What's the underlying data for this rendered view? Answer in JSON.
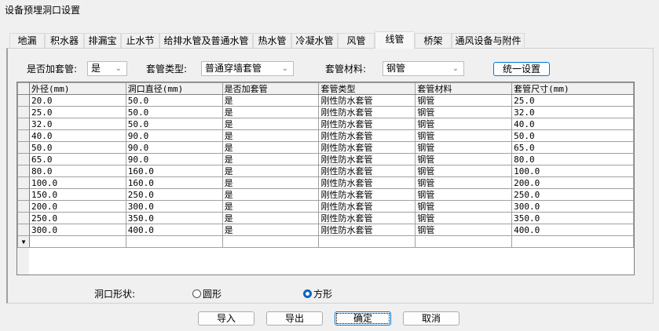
{
  "window": {
    "title": "设备预埋洞口设置"
  },
  "tabs": [
    "地漏",
    "积水器",
    "排漏宝",
    "止水节",
    "给排水管及普通水管",
    "热水管",
    "冷凝水管",
    "风管",
    "线管",
    "桥架",
    "通风设备与附件"
  ],
  "active_tab": "线管",
  "filters": {
    "add_sleeve_label": "是否加套管:",
    "add_sleeve_value": "是",
    "sleeve_type_label": "套管类型:",
    "sleeve_type_value": "普通穿墙套管",
    "sleeve_material_label": "套管材料:",
    "sleeve_material_value": "钢管",
    "apply_all_button": "统一设置"
  },
  "table": {
    "columns": [
      "外径(mm)",
      "洞口直径(mm)",
      "是否加套管",
      "套管类型",
      "套管材料",
      "套管尺寸(mm)"
    ],
    "rows": [
      [
        "20.0",
        "50.0",
        "是",
        "刚性防水套管",
        "钢管",
        "25.0"
      ],
      [
        "25.0",
        "50.0",
        "是",
        "刚性防水套管",
        "钢管",
        "32.0"
      ],
      [
        "32.0",
        "50.0",
        "是",
        "刚性防水套管",
        "钢管",
        "40.0"
      ],
      [
        "40.0",
        "90.0",
        "是",
        "刚性防水套管",
        "钢管",
        "50.0"
      ],
      [
        "50.0",
        "90.0",
        "是",
        "刚性防水套管",
        "钢管",
        "65.0"
      ],
      [
        "65.0",
        "90.0",
        "是",
        "刚性防水套管",
        "钢管",
        "80.0"
      ],
      [
        "80.0",
        "160.0",
        "是",
        "刚性防水套管",
        "钢管",
        "100.0"
      ],
      [
        "100.0",
        "160.0",
        "是",
        "刚性防水套管",
        "钢管",
        "200.0"
      ],
      [
        "150.0",
        "250.0",
        "是",
        "刚性防水套管",
        "钢管",
        "250.0"
      ],
      [
        "200.0",
        "300.0",
        "是",
        "刚性防水套管",
        "钢管",
        "300.0"
      ],
      [
        "250.0",
        "350.0",
        "是",
        "刚性防水套管",
        "钢管",
        "350.0"
      ],
      [
        "300.0",
        "400.0",
        "是",
        "刚性防水套管",
        "钢管",
        "400.0"
      ]
    ]
  },
  "shape": {
    "label": "洞口形状:",
    "options": [
      "圆形",
      "方形"
    ],
    "selected": "方形"
  },
  "buttons": {
    "import": "导入",
    "export": "导出",
    "ok": "确定",
    "cancel": "取消"
  }
}
